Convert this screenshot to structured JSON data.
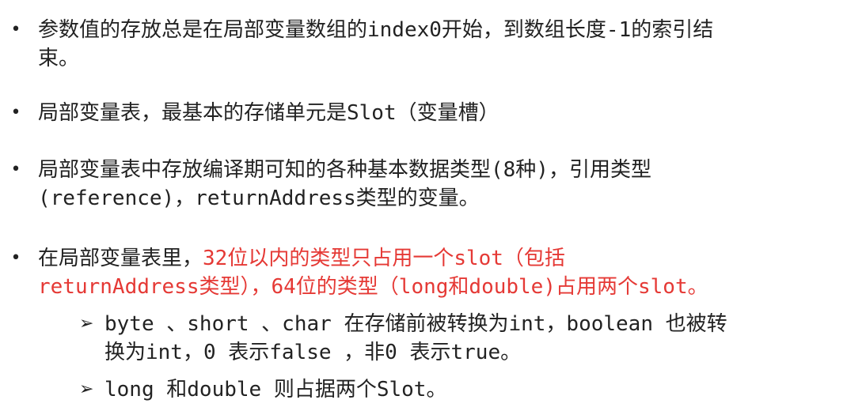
{
  "bullets": [
    {
      "line1": "参数值的存放总是在局部变量数组的index0开始，到数组长度-1的索引结",
      "line2": "束。"
    },
    {
      "line1": "局部变量表，最基本的存储单元是Slot（变量槽）"
    },
    {
      "line1": "局部变量表中存放编译期可知的各种基本数据类型(8种)，引用类型",
      "line2": "(reference)，returnAddress类型的变量。"
    },
    {
      "prefix": "在局部变量表里，",
      "red1": "32位以内的类型只占用一个slot（包括",
      "red2": "returnAddress类型），64位的类型（long和double)占用两个slot。"
    }
  ],
  "sub_bullets": [
    {
      "line1": "byte 、short 、char 在存储前被转换为int，boolean 也被转",
      "line2": "换为int，0 表示false ，非0 表示true。"
    },
    {
      "line1": "long 和double 则占据两个Slot。"
    }
  ],
  "symbols": {
    "bullet": "•",
    "arrow": "➢"
  }
}
